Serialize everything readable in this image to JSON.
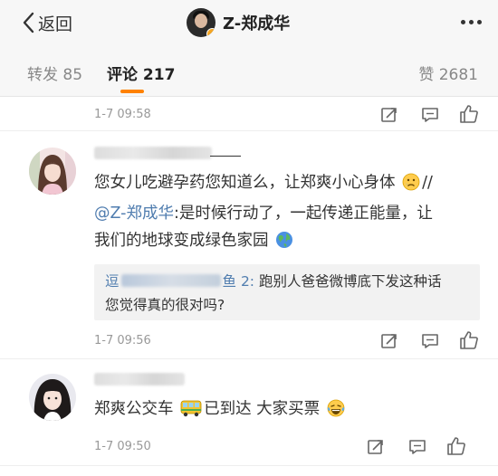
{
  "nav": {
    "back_label": "返回",
    "title": "Z-郑成华"
  },
  "tabs": {
    "repost_label": "转发",
    "repost_count": "85",
    "comment_label": "评论",
    "comment_count": "217",
    "like_label": "赞",
    "like_count": "2681"
  },
  "colors": {
    "accent": "#ff8200",
    "link": "#507daf",
    "meta": "#999999"
  },
  "comments": [
    {
      "time": "1-7 09:58"
    },
    {
      "text_1": "您女儿吃避孕药您知道么，让郑爽小心身体",
      "text_1b": "//",
      "mention": "@Z-郑成华",
      "text_2": ":是时候行动了，一起传递正能量，让",
      "text_3": "我们的地球变成绿色家园",
      "emoji_1": "sad-face-icon",
      "emoji_2": "earth-globe-icon",
      "reply_name_prefix": "逗",
      "reply_name_suffix": "鱼 2:",
      "reply_line_1": " 跑别人爸爸微博底下发这种话",
      "reply_line_2": "您觉得真的很对吗?",
      "time": "1-7 09:56"
    },
    {
      "text_1": "郑爽公交车",
      "text_2": "已到达 大家买票",
      "emoji_1": "bus-icon",
      "emoji_2": "laughing-tears-icon",
      "time": "1-7 09:50"
    }
  ]
}
